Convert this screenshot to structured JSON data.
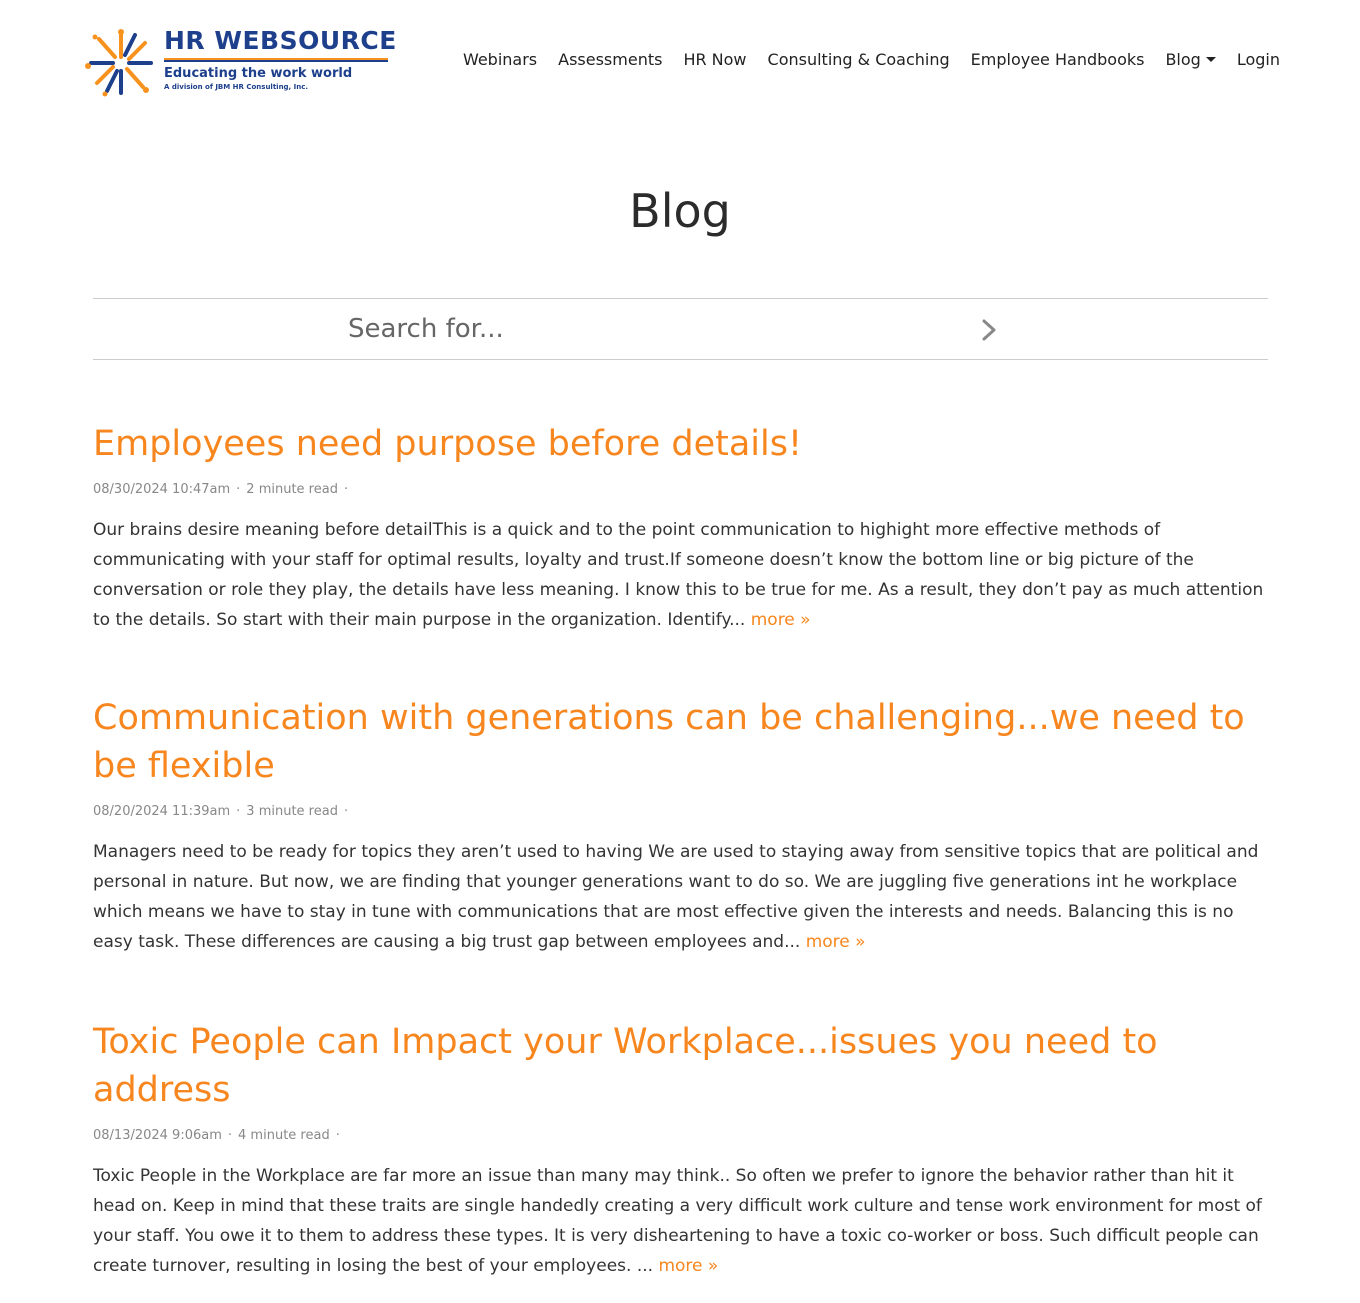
{
  "header": {
    "logo": {
      "title": "HR WEBSOURCE",
      "tagline": "Educating the work world",
      "division": "A division of JBM HR Consulting, Inc."
    },
    "nav": [
      {
        "label": "Webinars"
      },
      {
        "label": "Assessments"
      },
      {
        "label": "HR Now"
      },
      {
        "label": "Consulting & Coaching"
      },
      {
        "label": "Employee Handbooks"
      },
      {
        "label": "Blog",
        "has_dropdown": true
      },
      {
        "label": "Login"
      }
    ]
  },
  "page": {
    "title": "Blog"
  },
  "search": {
    "placeholder": "Search for..."
  },
  "posts": [
    {
      "title": "Employees need purpose before details!",
      "date": "08/30/2024 10:47am",
      "read_time": "2 minute read",
      "excerpt": "Our brains desire meaning before detailThis is a quick and to the point communication to highight more effective methods of communicating with your staff for optimal results, loyalty and trust.If someone doesn’t know the bottom line or big picture of the conversation or role they play, the details have less meaning.  I know this to be true for me.  As a result, they don’t pay as much attention to the details. So start with their main purpose in the organization.  Identify...",
      "more_label": "more »"
    },
    {
      "title": "Communication with generations can be challenging...we need to be flexible",
      "date": "08/20/2024 11:39am",
      "read_time": "3 minute read",
      "excerpt": "Managers need to be ready for topics they aren’t used to having We are used to staying away from sensitive topics that are political and personal in nature.  But now, we are finding that younger generations want to do so.  We are juggling five generations int he workplace which means we have to stay in tune with communications that are most effective given the interests and needs.  Balancing this is no easy task. These differences are causing a big trust gap between employees and...",
      "more_label": "more »"
    },
    {
      "title": "Toxic People can Impact your Workplace...issues you need to address",
      "date": "08/13/2024 9:06am",
      "read_time": "4 minute read",
      "excerpt": "Toxic People in the Workplace are far more an issue than many may think.. So often we prefer to ignore the behavior rather than hit it head on.  Keep in mind that these traits are single handedly creating a very difficult work culture and tense work environment for most of your staff.  You owe it to them to address these types.   It is very disheartening to have a toxic co-worker or boss.  Such difficult people can create turnover, resulting in losing the best of your employees. ...",
      "more_label": "more »"
    }
  ],
  "colors": {
    "accent": "#f7861e",
    "brand_blue": "#1d3f8c",
    "text": "#333333",
    "meta": "#888888"
  },
  "icons": {
    "logo_mark": "starburst-logo-icon",
    "search_submit": "chevron-right-icon",
    "dropdown": "caret-down-icon"
  }
}
